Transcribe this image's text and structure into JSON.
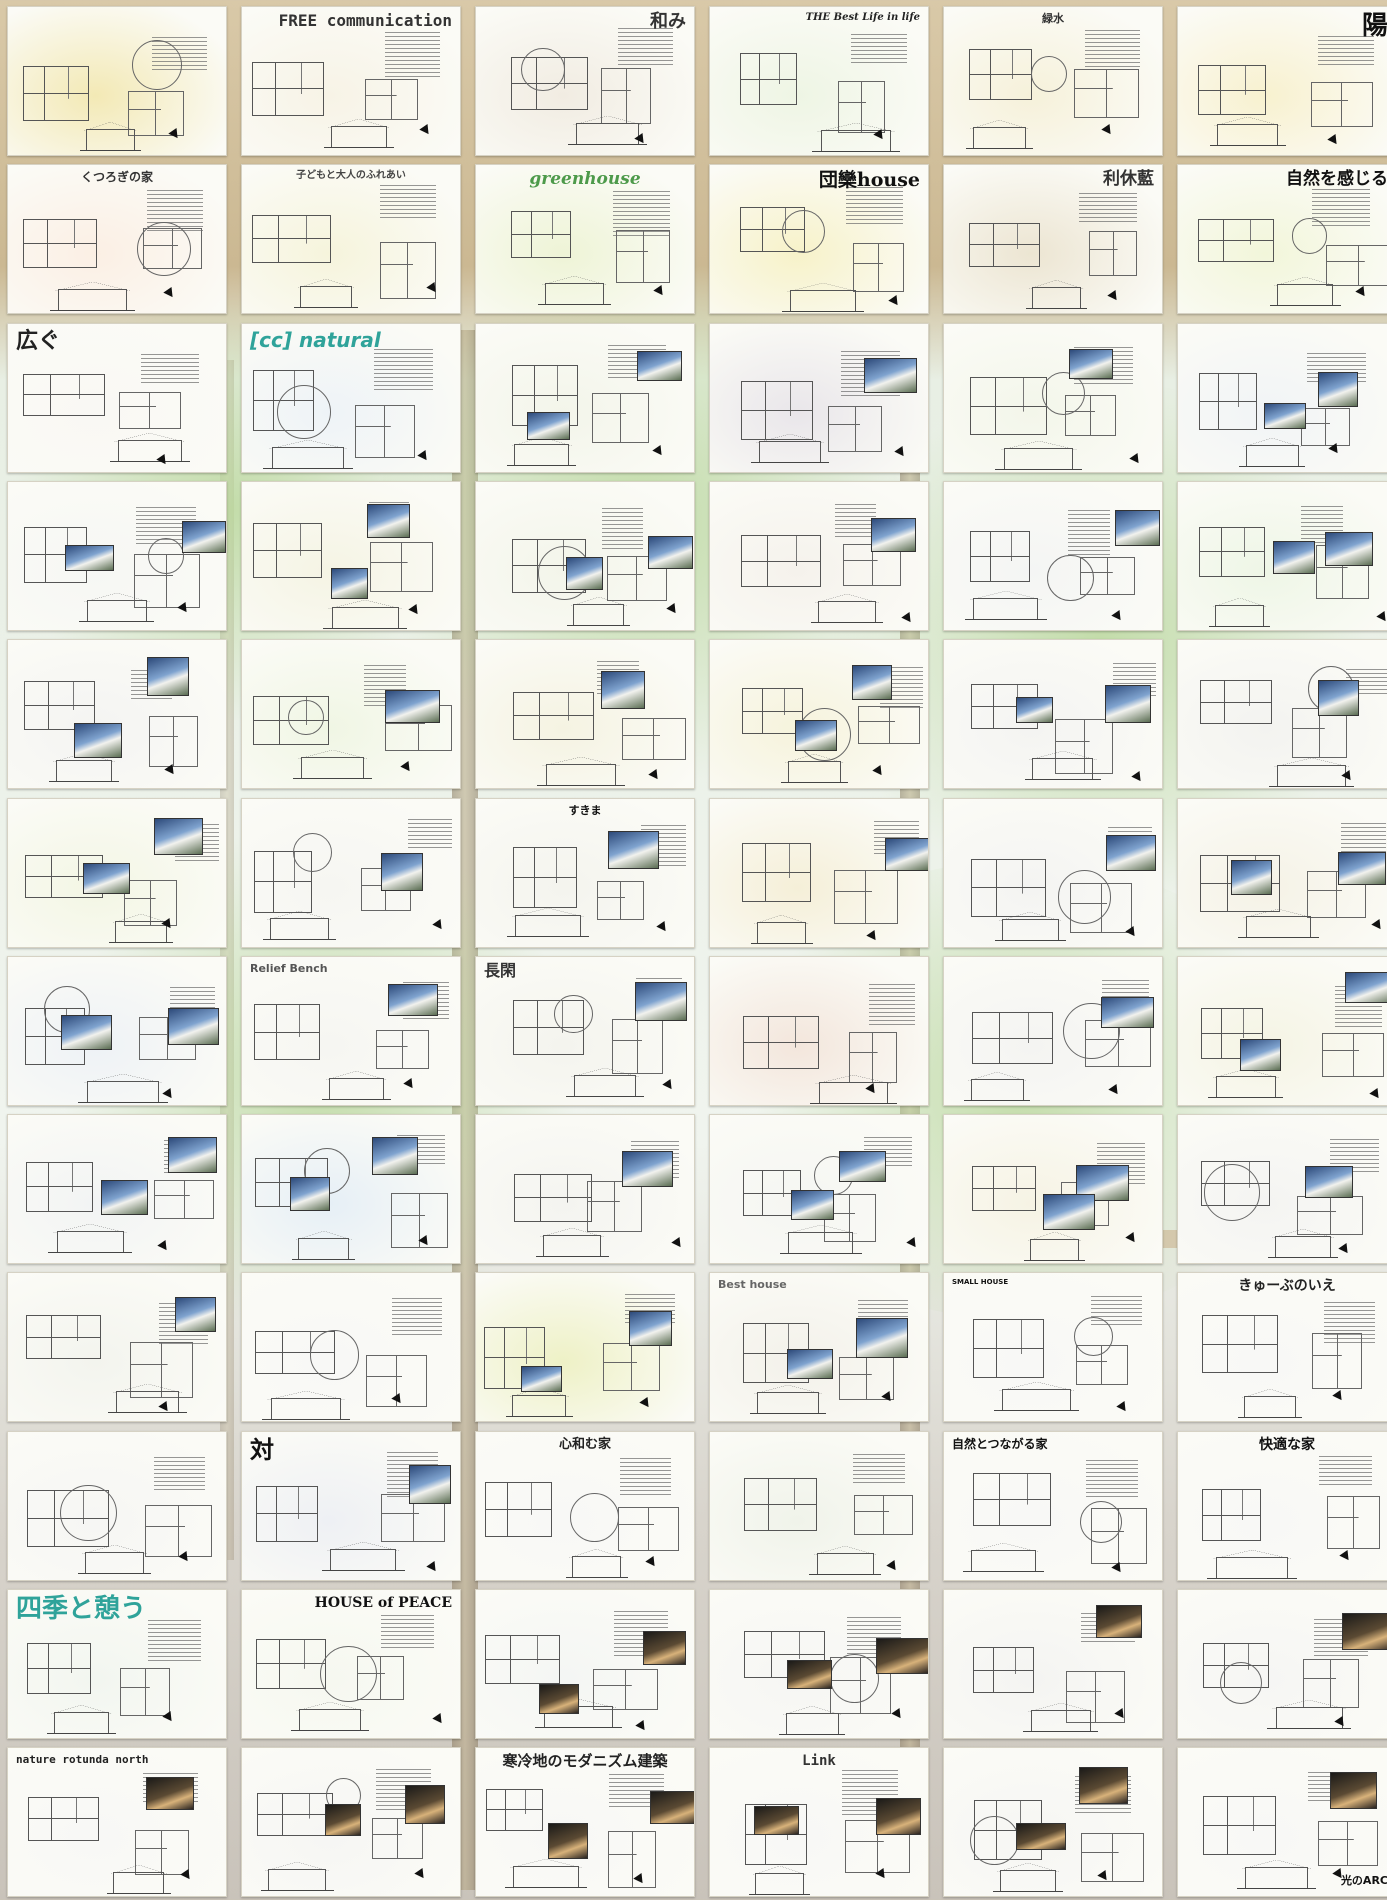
{
  "columns": 6,
  "rows": 12,
  "colors": {
    "board": "#fbfbf6",
    "title_dark": "#222222",
    "title_green": "#4d9a4a",
    "title_teal": "#2fa39a",
    "title_orange": "#e5881e",
    "title_blue": "#3a6fb0"
  },
  "boards": [
    {
      "title": "",
      "wash": "#f3e9b5",
      "photo": false
    },
    {
      "title": "FREE communication",
      "wash": "#f7f3e6",
      "photo": false
    },
    {
      "title": "和み",
      "wash": "#f1ece2",
      "photo": false
    },
    {
      "title": "THE Best Life in life",
      "wash": "#eef5e4",
      "photo": false
    },
    {
      "title": "緑水",
      "wash": "#f6f1da",
      "photo": false
    },
    {
      "title": "陽",
      "wash": "#f8f1cf",
      "photo": false
    },
    {
      "title": "くつろぎの家",
      "wash": "#fbefe4",
      "photo": false
    },
    {
      "title": "子どもと大人のふれあい",
      "wash": "#f6f4dc",
      "photo": false
    },
    {
      "title": "greenhouse",
      "wash": "#eef4d6",
      "photo": false
    },
    {
      "title": "団欒house",
      "wash": "#f7f2c9",
      "photo": false
    },
    {
      "title": "利休藍",
      "wash": "#ece5d2",
      "photo": false
    },
    {
      "title": "自然を感じる",
      "wash": "#f2f6da",
      "photo": false
    },
    {
      "title": "広ぐ",
      "wash": "#f9f8f4",
      "photo": false
    },
    {
      "title": "[cc] natural",
      "wash": "#eef3f7",
      "photo": false
    },
    {
      "title": "",
      "wash": "#f3f5ea",
      "photo": true
    },
    {
      "title": "",
      "wash": "#e9e6ea",
      "photo": true
    },
    {
      "title": "",
      "wash": "#f3f6ea",
      "photo": true
    },
    {
      "title": "",
      "wash": "#f1f4f6",
      "photo": true
    },
    {
      "title": "",
      "wash": "#f6f7f4",
      "photo": true
    },
    {
      "title": "",
      "wash": "#f5f4e4",
      "photo": true
    },
    {
      "title": "",
      "wash": "#f3f5ea",
      "photo": true
    },
    {
      "title": "",
      "wash": "#f5f2ec",
      "photo": true
    },
    {
      "title": "",
      "wash": "#f4f5f4",
      "photo": true
    },
    {
      "title": "",
      "wash": "#eef6e6",
      "photo": true
    },
    {
      "title": "",
      "wash": "#f4f4f2",
      "photo": true
    },
    {
      "title": "",
      "wash": "#f0f6e4",
      "photo": true
    },
    {
      "title": "",
      "wash": "#f5f3e2",
      "photo": true
    },
    {
      "title": "",
      "wash": "#f6f3dc",
      "photo": true
    },
    {
      "title": "",
      "wash": "#f4f4f2",
      "photo": true
    },
    {
      "title": "",
      "wash": "#f3f3f0",
      "photo": true
    },
    {
      "title": "",
      "wash": "#f3f6e4",
      "photo": true
    },
    {
      "title": "",
      "wash": "#f6f6f2",
      "photo": true
    },
    {
      "title": "すきま",
      "wash": "#f4f4ee",
      "photo": true
    },
    {
      "title": "",
      "wash": "#f5efd8",
      "photo": true
    },
    {
      "title": "",
      "wash": "#f4f4f2",
      "photo": true
    },
    {
      "title": "",
      "wash": "#f5f2e6",
      "photo": true
    },
    {
      "title": "",
      "wash": "#eef2f6",
      "photo": true
    },
    {
      "title": "Relief Bench",
      "wash": "#f6f6f2",
      "photo": true
    },
    {
      "title": "長閑",
      "wash": "#f4f4ee",
      "photo": true
    },
    {
      "title": "",
      "wash": "#f3e6dc",
      "photo": false
    },
    {
      "title": "",
      "wash": "#f4f4f2",
      "photo": true
    },
    {
      "title": "",
      "wash": "#f5f4e4",
      "photo": true
    },
    {
      "title": "",
      "wash": "#f2f4f4",
      "photo": true
    },
    {
      "title": "",
      "wash": "#e6eff6",
      "photo": true
    },
    {
      "title": "",
      "wash": "#f4f4f0",
      "photo": true
    },
    {
      "title": "",
      "wash": "#f5f6f2",
      "photo": true
    },
    {
      "title": "",
      "wash": "#f6f3e4",
      "photo": true
    },
    {
      "title": "",
      "wash": "#f4f4f2",
      "photo": true
    },
    {
      "title": "",
      "wash": "#f3f4ee",
      "photo": true
    },
    {
      "title": "",
      "wash": "#f8f8f6",
      "photo": false
    },
    {
      "title": "",
      "wash": "#eef1c6",
      "photo": true
    },
    {
      "title": "Best house",
      "wash": "#f3f1ea",
      "photo": true
    },
    {
      "title": "SMALL HOUSE",
      "wash": "#f8f8f6",
      "photo": false
    },
    {
      "title": "きゅーぶのいえ",
      "wash": "#f8f8f6",
      "photo": false
    },
    {
      "title": "",
      "wash": "#f6f6f4",
      "photo": false
    },
    {
      "title": "対",
      "wash": "#eef0f4",
      "photo": true
    },
    {
      "title": "心和む家",
      "wash": "#f8f8f6",
      "photo": false
    },
    {
      "title": "",
      "wash": "#f0f3ea",
      "photo": false
    },
    {
      "title": "自然とつながる家",
      "wash": "#f8f8f6",
      "photo": false
    },
    {
      "title": "快適な家",
      "wash": "#f8f8f6",
      "photo": false
    },
    {
      "title": "四季と憩う",
      "wash": "#f2f6f0",
      "photo": false
    },
    {
      "title": "HOUSE of PEACE",
      "wash": "#f6f8f0",
      "photo": false
    },
    {
      "title": "",
      "wash": "#f4f6f4",
      "photo": true
    },
    {
      "title": "",
      "wash": "#f6f6f4",
      "photo": true
    },
    {
      "title": "",
      "wash": "#f4f4f2",
      "photo": true
    },
    {
      "title": "",
      "wash": "#f6f6f4",
      "photo": true
    },
    {
      "title": "nature rotunda north",
      "wash": "#f8f8f6",
      "photo": true
    },
    {
      "title": "",
      "wash": "#f6f6f4",
      "photo": true
    },
    {
      "title": "寒冷地のモダニズム建築",
      "wash": "#f8f8f6",
      "photo": true
    },
    {
      "title": "Link",
      "wash": "#f8f8f6",
      "photo": true
    },
    {
      "title": "",
      "wash": "#f6f6f4",
      "photo": true
    },
    {
      "title": "光のARC",
      "wash": "#f8f8f6",
      "photo": true
    }
  ]
}
